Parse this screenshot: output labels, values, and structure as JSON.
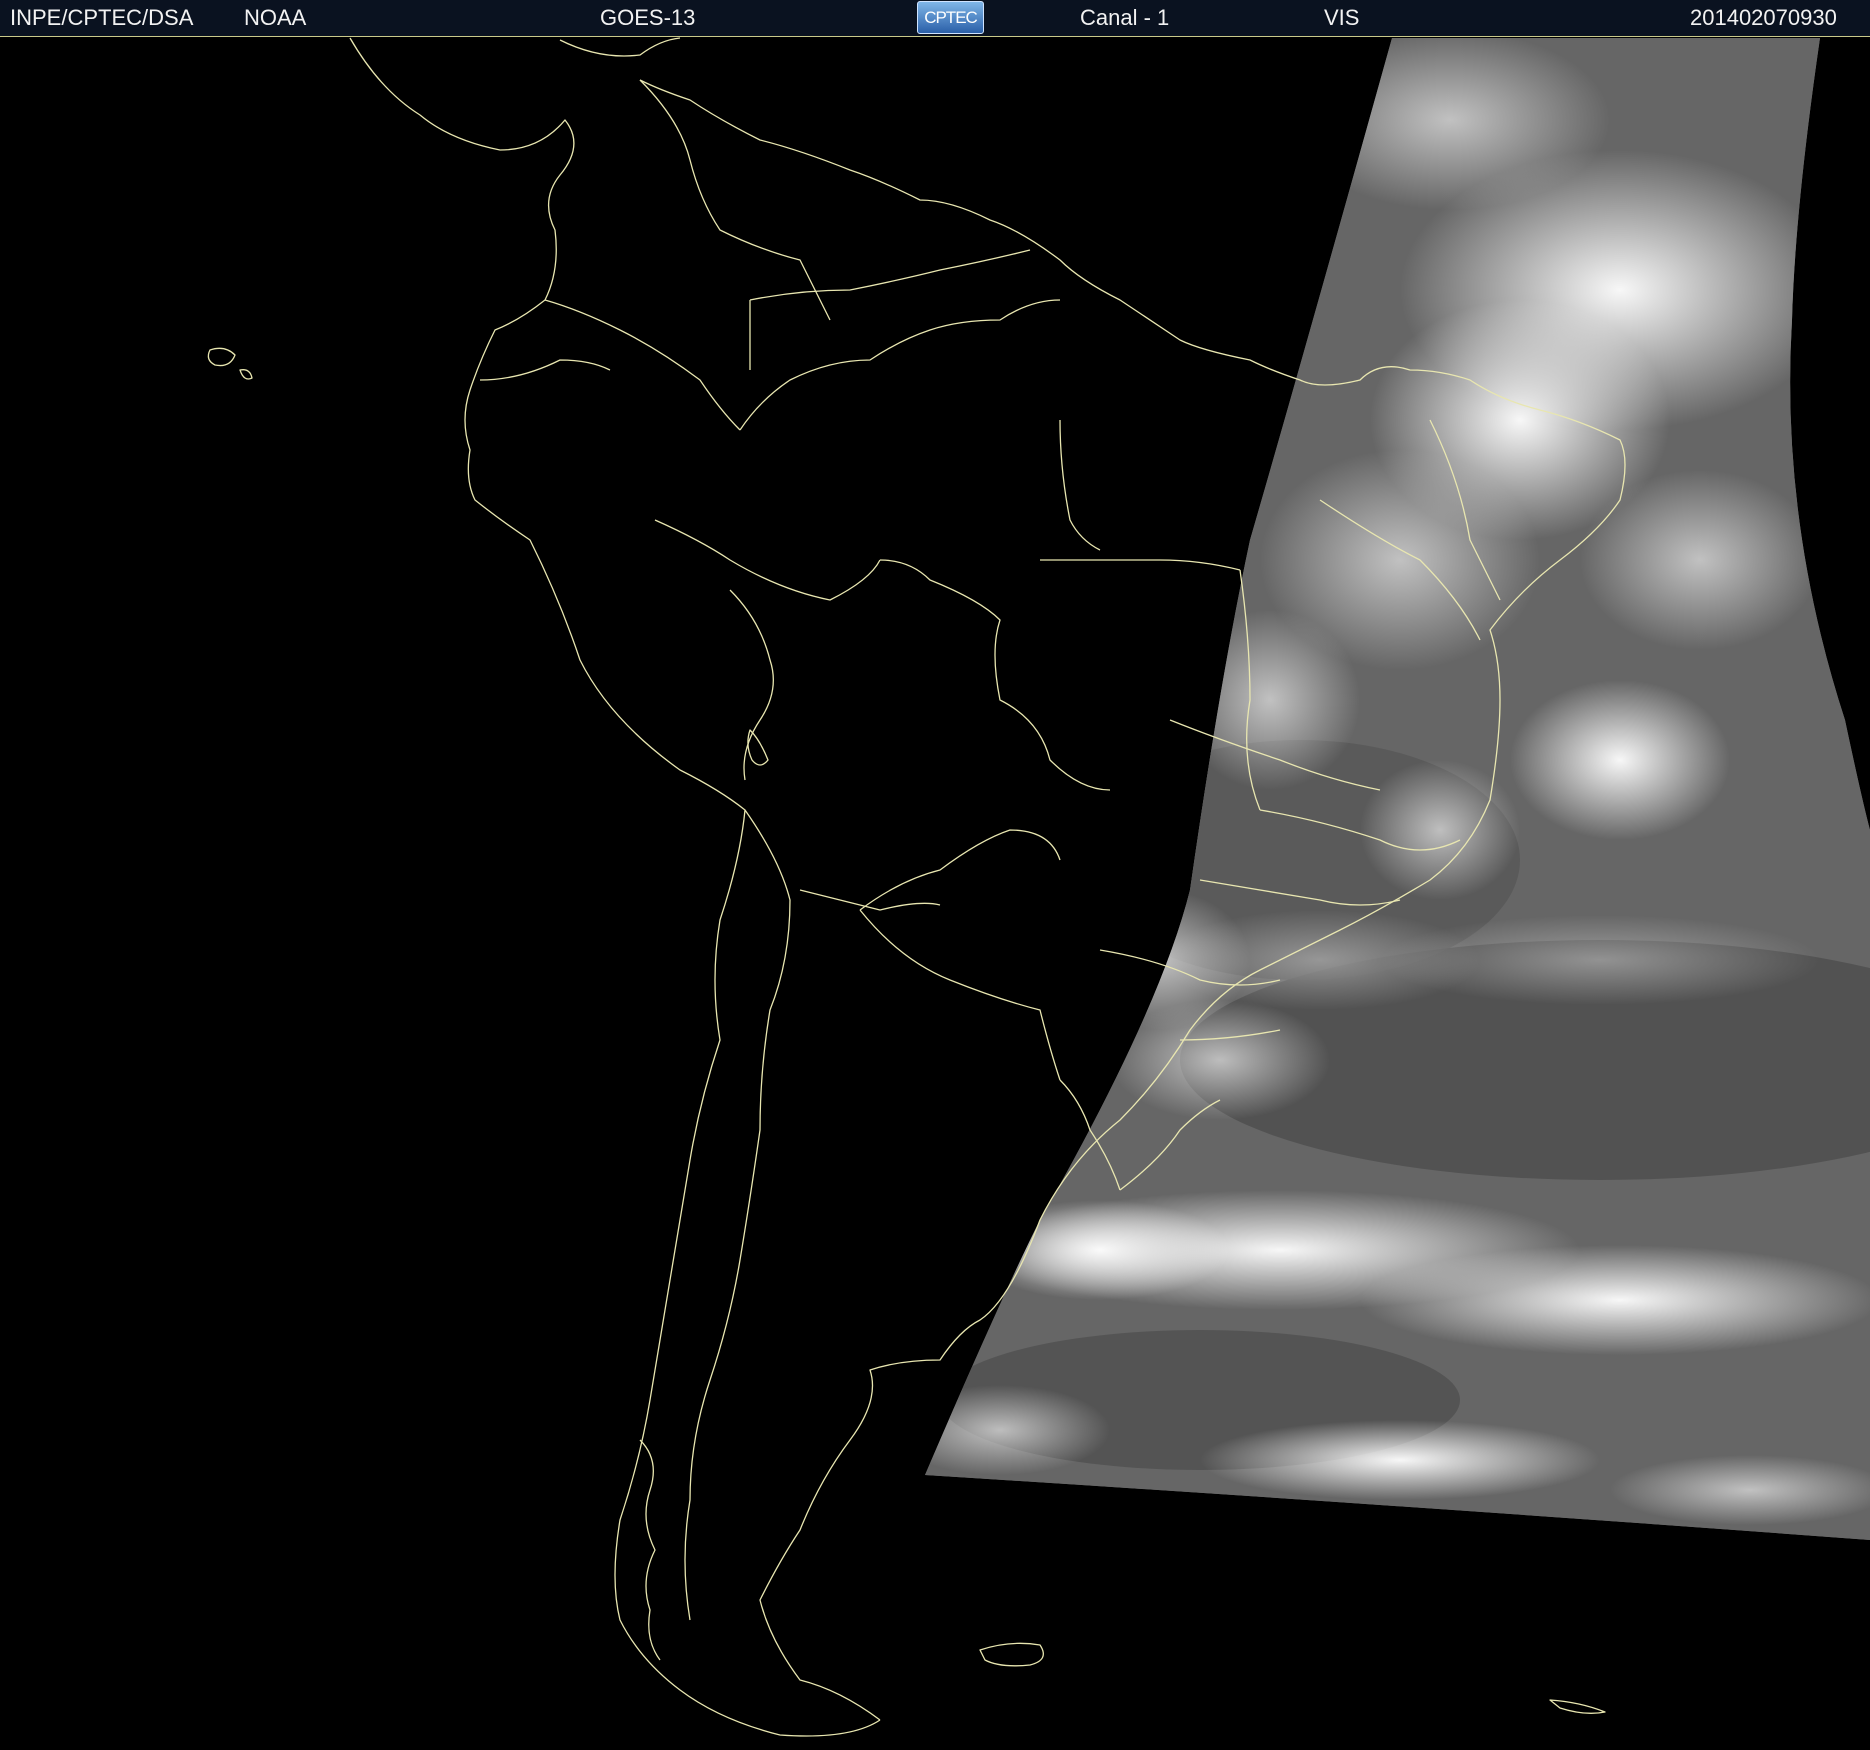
{
  "header": {
    "source": "INPE/CPTEC/DSA",
    "agency": "NOAA",
    "satellite": "GOES-13",
    "logo_text": "CPTEC",
    "channel": "Canal - 1",
    "band": "VIS",
    "timestamp": "201402070930"
  },
  "colors": {
    "background": "#000000",
    "border_lines": "#e8e6b0",
    "header_bg": "#0a1220"
  }
}
